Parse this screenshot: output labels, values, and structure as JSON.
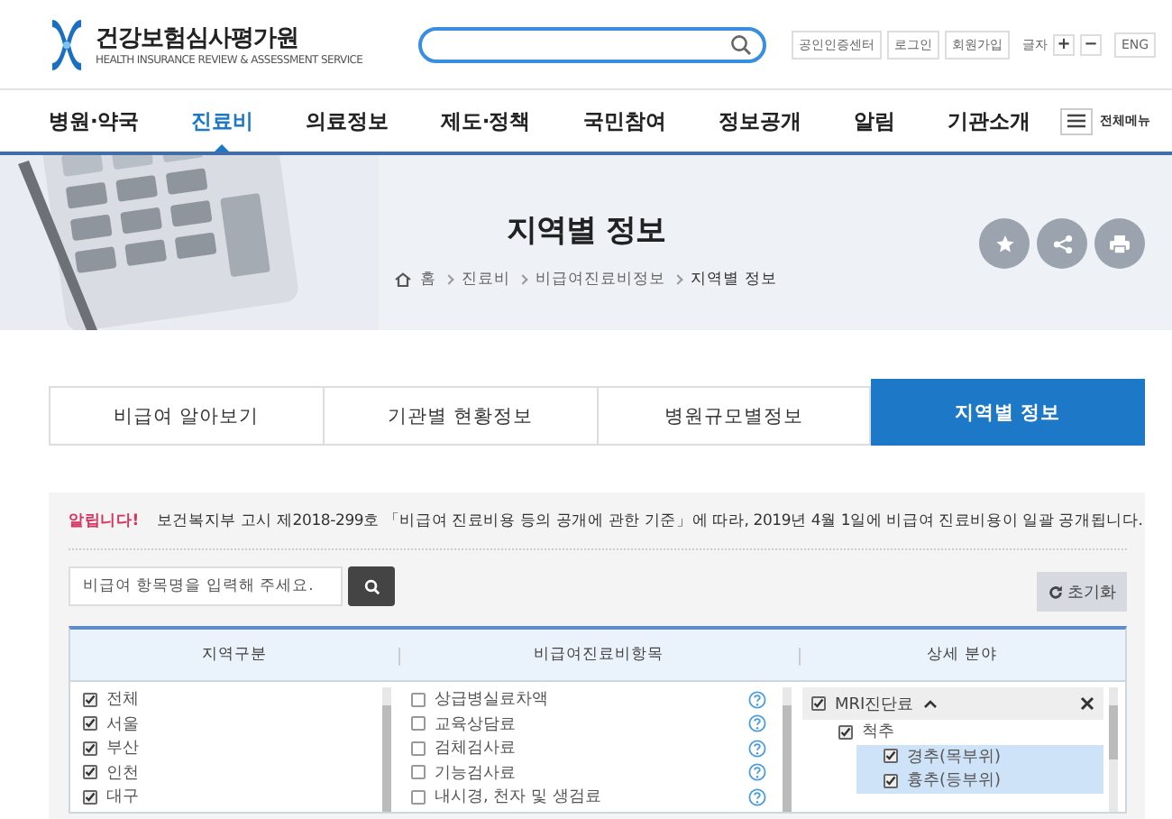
{
  "logo": {
    "name": "건강보험심사평가원",
    "subtitle": "HEALTH INSURANCE REVIEW & ASSESSMENT SERVICE"
  },
  "util_links": [
    "공인인증센터",
    "로그인",
    "회원가입"
  ],
  "font_size": {
    "label": "글자",
    "increase": "+",
    "decrease": "−"
  },
  "language": "ENG",
  "nav": [
    {
      "label": "병원·약국",
      "selected": false
    },
    {
      "label": "진료비",
      "selected": true
    },
    {
      "label": "의료정보",
      "selected": false
    },
    {
      "label": "제도·정책",
      "selected": false
    },
    {
      "label": "국민참여",
      "selected": false
    },
    {
      "label": "정보공개",
      "selected": false
    },
    {
      "label": "알림",
      "selected": false
    },
    {
      "label": "기관소개",
      "selected": false
    }
  ],
  "all_menu": "전체메뉴",
  "page": {
    "title": "지역별 정보",
    "breadcrumb": [
      "홈",
      "진료비",
      "비급여진료비정보",
      "지역별 정보"
    ]
  },
  "tabs": [
    {
      "label": "비급여 알아보기",
      "selected": false
    },
    {
      "label": "기관별 현황정보",
      "selected": false
    },
    {
      "label": "병원규모별정보",
      "selected": false
    },
    {
      "label": "지역별 정보",
      "selected": true
    }
  ],
  "notice": {
    "label": "알립니다!",
    "text": "보건복지부 고시 제2018-299호 「비급여 진료비용 등의 공개에 관한 기준」에 따라, 2019년 4월 1일에 비급여 진료비용이 일괄 공개됩니다."
  },
  "item_search": {
    "placeholder": "비급여 항목명을 입력해 주세요."
  },
  "reset_button": "초기화",
  "columns": [
    "지역구분",
    "비급여진료비항목",
    "상세 분야"
  ],
  "regions": [
    {
      "label": "전체",
      "checked": true
    },
    {
      "label": "서울",
      "checked": true
    },
    {
      "label": "부산",
      "checked": true
    },
    {
      "label": "인천",
      "checked": true
    },
    {
      "label": "대구",
      "checked": true
    }
  ],
  "items": [
    {
      "label": "상급병실료차액",
      "checked": false
    },
    {
      "label": "교육상담료",
      "checked": false
    },
    {
      "label": "검체검사료",
      "checked": false
    },
    {
      "label": "기능검사료",
      "checked": false
    },
    {
      "label": "내시경, 천자 및 생검료",
      "checked": false
    }
  ],
  "details": [
    {
      "label": "MRI진단료",
      "checked": true,
      "expanded": true,
      "children": [
        {
          "label": "척추",
          "checked": true,
          "children": [
            {
              "label": "경추(목부위)",
              "checked": true,
              "selected": true
            },
            {
              "label": "흉추(등부위)",
              "checked": true,
              "selected": true
            }
          ]
        }
      ]
    }
  ]
}
